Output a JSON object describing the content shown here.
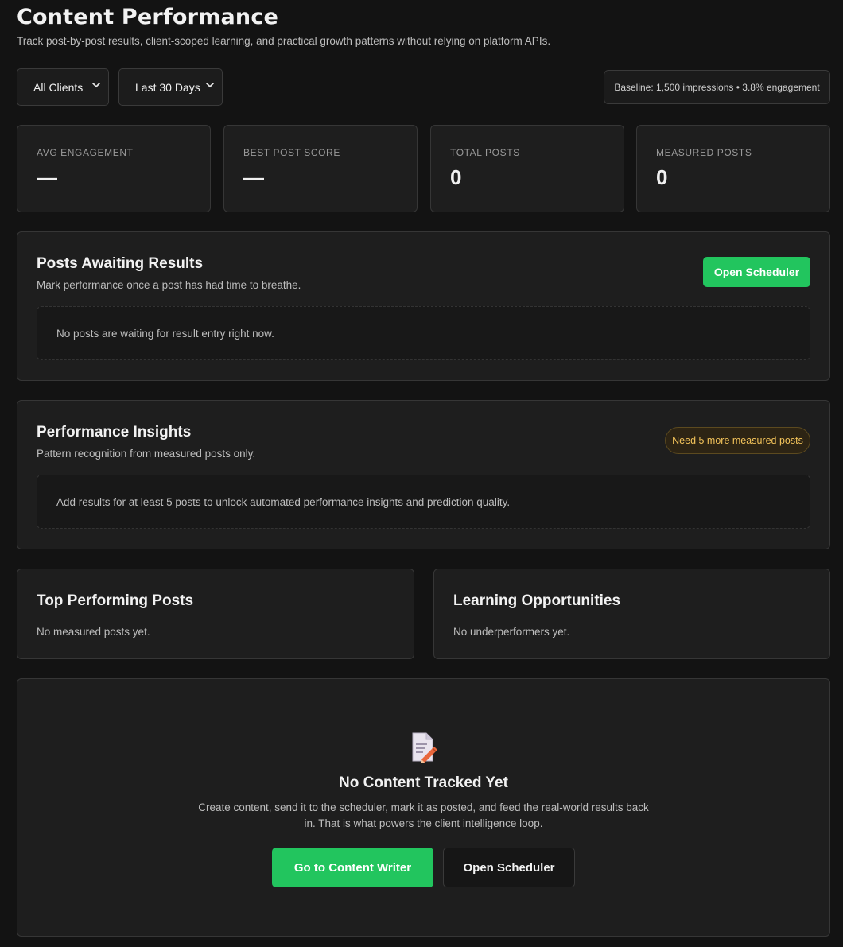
{
  "header": {
    "title": "Content Performance",
    "subtitle": "Track post-by-post results, client-scoped learning, and practical growth patterns without relying on platform APIs."
  },
  "filters": {
    "client": "All Clients",
    "range": "Last 30 Days",
    "baseline": "Baseline: 1,500 impressions • 3.8% engagement"
  },
  "stats": [
    {
      "label": "AVG ENGAGEMENT",
      "value": "—"
    },
    {
      "label": "BEST POST SCORE",
      "value": "—"
    },
    {
      "label": "TOTAL POSTS",
      "value": "0"
    },
    {
      "label": "MEASURED POSTS",
      "value": "0"
    }
  ],
  "awaiting": {
    "title": "Posts Awaiting Results",
    "desc": "Mark performance once a post has had time to breathe.",
    "button": "Open Scheduler",
    "empty": "No posts are waiting for result entry right now."
  },
  "insights": {
    "title": "Performance Insights",
    "desc": "Pattern recognition from measured posts only.",
    "badge": "Need 5 more measured posts",
    "empty": "Add results for at least 5 posts to unlock automated performance insights and prediction quality."
  },
  "top": {
    "title": "Top Performing Posts",
    "empty": "No measured posts yet."
  },
  "learning": {
    "title": "Learning Opportunities",
    "empty": "No underperformers yet."
  },
  "empty_state": {
    "icon": "memo-pencil-icon",
    "title": "No Content Tracked Yet",
    "desc": "Create content, send it to the scheduler, mark it as posted, and feed the real-world results back in. That is what powers the client intelligence loop.",
    "primary": "Go to Content Writer",
    "secondary": "Open Scheduler"
  },
  "colors": {
    "background": "#131313",
    "card": "#1e1e1e",
    "accent_green": "#22c55e",
    "warning_text": "#f3c35a"
  }
}
